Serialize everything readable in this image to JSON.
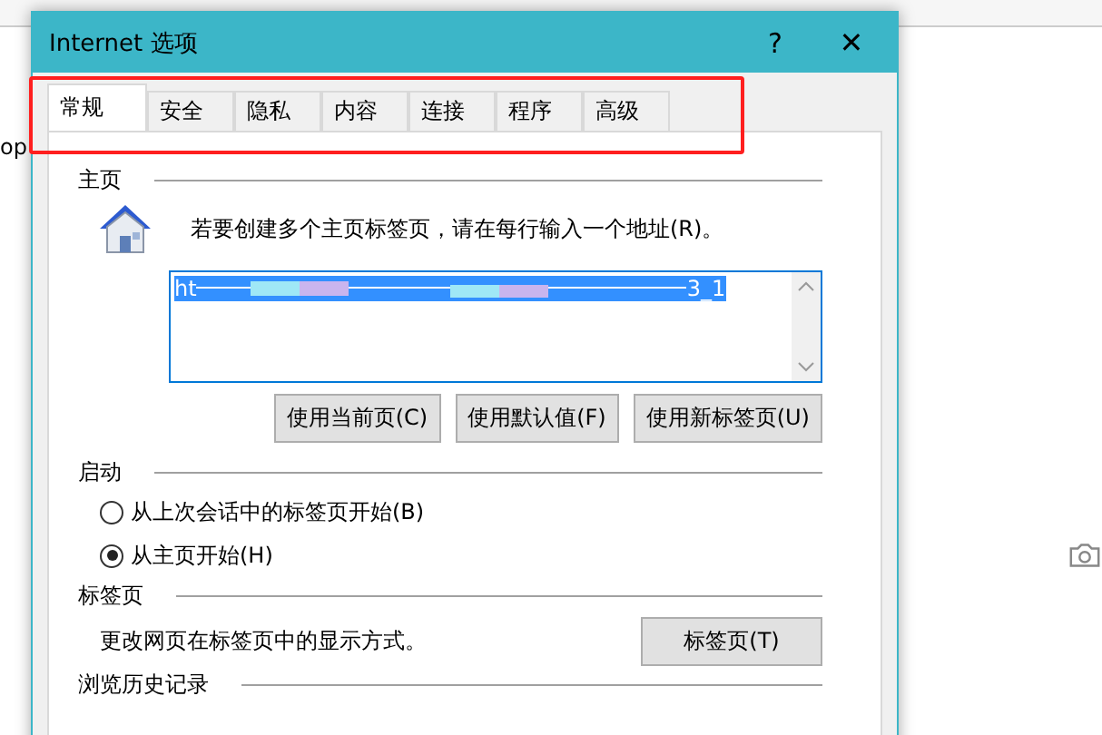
{
  "background": {
    "side_text": "op"
  },
  "window": {
    "title": "Internet 选项",
    "help": "?",
    "close": "✕"
  },
  "tabs": [
    {
      "label": "常规",
      "selected": true
    },
    {
      "label": "安全",
      "selected": false
    },
    {
      "label": "隐私",
      "selected": false
    },
    {
      "label": "内容",
      "selected": false
    },
    {
      "label": "连接",
      "selected": false
    },
    {
      "label": "程序",
      "selected": false
    },
    {
      "label": "高级",
      "selected": false
    }
  ],
  "home": {
    "heading": "主页",
    "hint": "若要创建多个主页标签页，请在每行输入一个地址(R)。",
    "value_start": "ht",
    "value_end": "3_1",
    "selected": true,
    "buttons": [
      "使用当前页(C)",
      "使用默认值(F)",
      "使用新标签页(U)"
    ]
  },
  "startup": {
    "heading": "启动",
    "options": [
      {
        "label": "从上次会话中的标签页开始(B)",
        "selected": false
      },
      {
        "label": "从主页开始(H)",
        "selected": true
      }
    ]
  },
  "tabs_section": {
    "heading": "标签页",
    "text": "更改网页在标签页中的显示方式。",
    "button": "标签页(T)"
  },
  "history": {
    "heading": "浏览历史记录"
  }
}
